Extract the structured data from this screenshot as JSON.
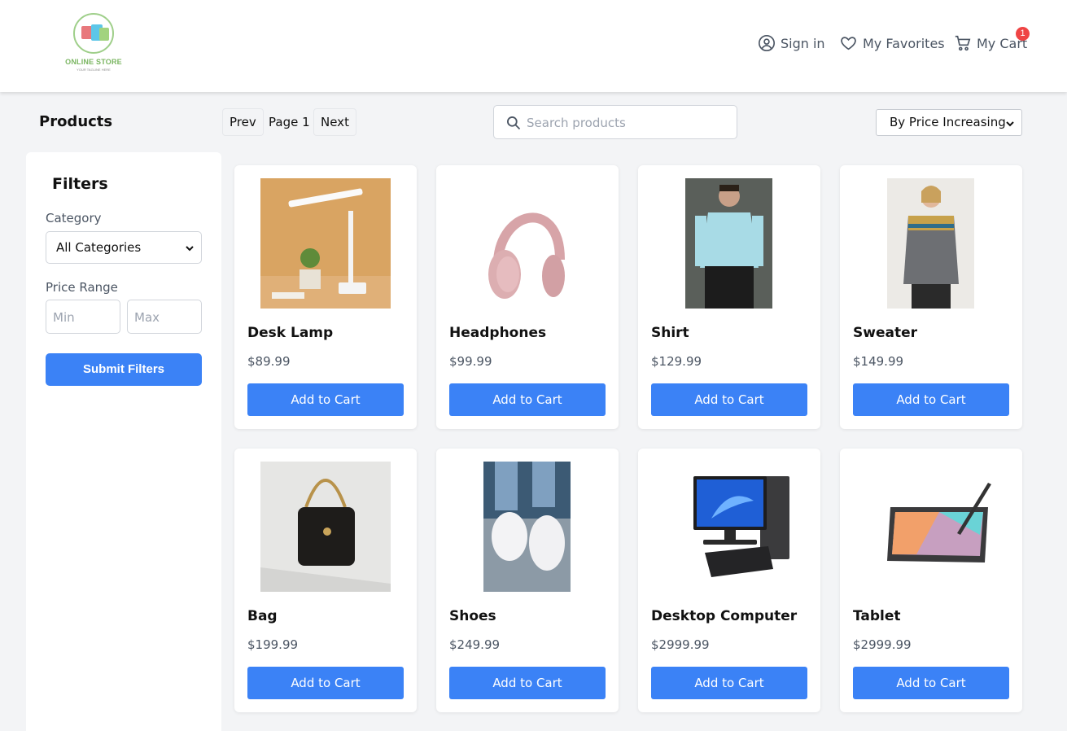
{
  "brand": {
    "name": "ONLINE STORE",
    "tagline": "YOUR TAGLINE HERE"
  },
  "nav": {
    "signin": {
      "label": "Sign in",
      "icon": "user-circle-icon"
    },
    "favorites": {
      "label": "My Favorites",
      "icon": "heart-icon"
    },
    "cart": {
      "label": "My Cart",
      "icon": "cart-icon",
      "badge": "1"
    }
  },
  "toolbar": {
    "title": "Products",
    "prev_label": "Prev",
    "page_label": "Page 1",
    "next_label": "Next",
    "search_placeholder": "Search products",
    "sort_value": "By Price Increasing"
  },
  "filters": {
    "title": "Filters",
    "category_label": "Category",
    "category_value": "All Categories",
    "price_label": "Price Range",
    "min_placeholder": "Min",
    "max_placeholder": "Max",
    "submit_label": "Submit Filters"
  },
  "products": [
    {
      "name": "Desk Lamp",
      "price": "$89.99",
      "cta": "Add to Cart"
    },
    {
      "name": "Headphones",
      "price": "$99.99",
      "cta": "Add to Cart"
    },
    {
      "name": "Shirt",
      "price": "$129.99",
      "cta": "Add to Cart"
    },
    {
      "name": "Sweater",
      "price": "$149.99",
      "cta": "Add to Cart"
    },
    {
      "name": "Bag",
      "price": "$199.99",
      "cta": "Add to Cart"
    },
    {
      "name": "Shoes",
      "price": "$249.99",
      "cta": "Add to Cart"
    },
    {
      "name": "Desktop Computer",
      "price": "$2999.99",
      "cta": "Add to Cart"
    },
    {
      "name": "Tablet",
      "price": "$2999.99",
      "cta": "Add to Cart"
    }
  ],
  "colors": {
    "primary": "#3b82f6",
    "badge": "#ef4444",
    "background": "#f3f4f6",
    "brand_green": "#7bb662"
  }
}
